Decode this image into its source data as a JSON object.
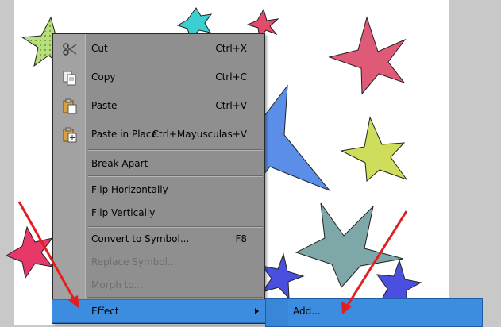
{
  "context_menu": {
    "items": [
      {
        "label": "Cut",
        "mnemonic_index": 2,
        "shortcut": "Ctrl+X",
        "icon": "scissors-icon",
        "enabled": true
      },
      {
        "label": "Copy",
        "shortcut": "Ctrl+C",
        "icon": "copy-icon",
        "enabled": true
      },
      {
        "label": "Paste",
        "shortcut": "Ctrl+V",
        "icon": "paste-icon",
        "enabled": true
      },
      {
        "label": "Paste in Place",
        "shortcut": "Ctrl+Mayusculas+V",
        "icon": "paste-in-place-icon",
        "enabled": true
      },
      {
        "label": "Break Apart",
        "shortcut": "",
        "enabled": true
      },
      {
        "label": "Flip Horizontally",
        "shortcut": "",
        "enabled": true
      },
      {
        "label": "Flip Vertically",
        "shortcut": "",
        "enabled": true
      },
      {
        "label": "Convert to Symbol...",
        "shortcut": "F8",
        "enabled": true
      },
      {
        "label": "Replace Symbol...",
        "shortcut": "",
        "enabled": false
      },
      {
        "label": "Morph to...",
        "shortcut": "",
        "enabled": false
      },
      {
        "label": "Effect",
        "shortcut": "",
        "enabled": true,
        "has_submenu": true,
        "highlighted": true
      }
    ]
  },
  "submenu": {
    "items": [
      {
        "label": "Add...",
        "highlighted": true
      }
    ]
  },
  "colors": {
    "menu_bg": "#8f8f8f",
    "highlight": "#3c8de0",
    "annotation_arrow": "#e02020"
  }
}
